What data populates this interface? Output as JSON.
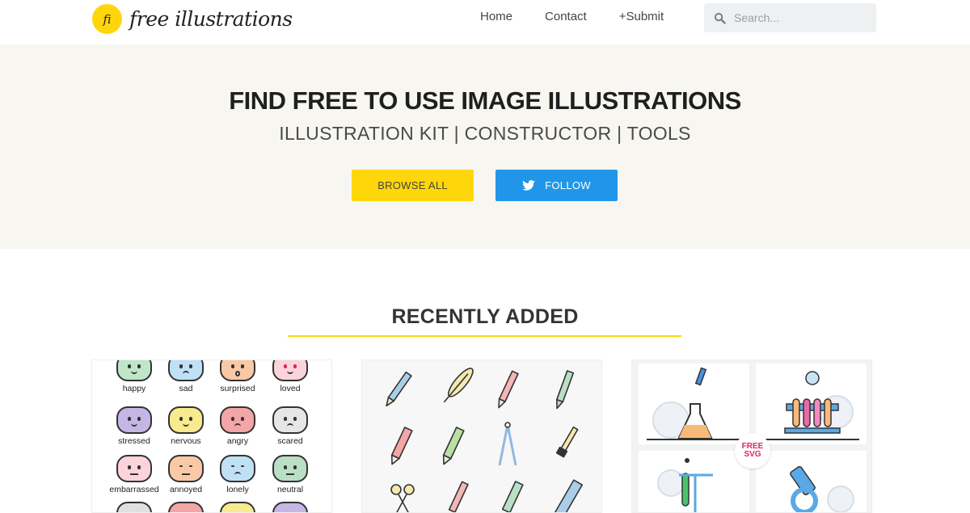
{
  "header": {
    "logo_mark": "fi",
    "logo_text": "free illustrations",
    "nav": [
      "Home",
      "Contact",
      "+Submit"
    ],
    "search_placeholder": "Search..."
  },
  "hero": {
    "title": "FIND FREE TO USE IMAGE ILLUSTRATIONS",
    "subtitle": "ILLUSTRATION KIT | CONSTRUCTOR | TOOLS",
    "browse_label": "BROWSE ALL",
    "follow_label": "FOLLOW"
  },
  "recent": {
    "title": "RECENTLY ADDED",
    "emotions": [
      "happy",
      "sad",
      "surprised",
      "loved",
      "stressed",
      "nervous",
      "angry",
      "scared",
      "embarrassed",
      "annoyed",
      "lonely",
      "neutral"
    ],
    "badge_line1": "FREE",
    "badge_line2": "SVG"
  },
  "colors": {
    "accent_yellow": "#FFD60A",
    "twitter_blue": "#2196e8",
    "hero_bg": "#f7f6f1"
  }
}
